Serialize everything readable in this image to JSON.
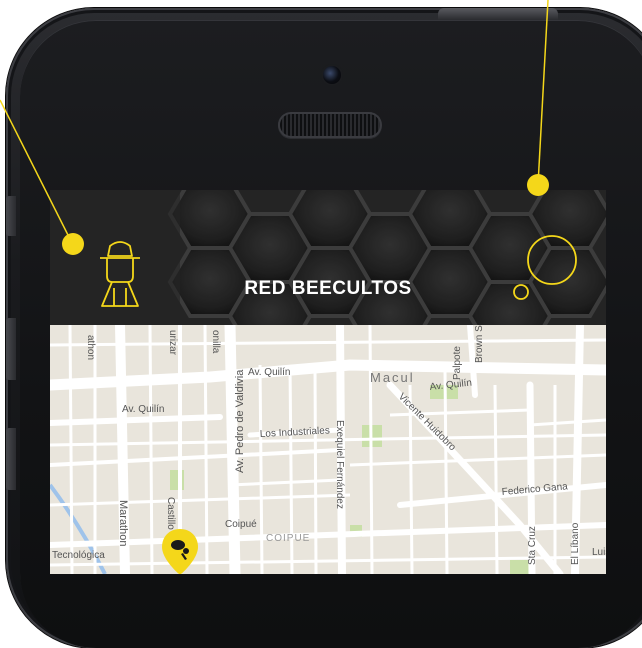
{
  "app": {
    "title": "RED BEECULTOS"
  },
  "colors": {
    "accent": "#f4d71a",
    "header_bg": "#2a2a2a",
    "map_bg": "#e8e4dc",
    "road": "#ffffff"
  },
  "icons": {
    "logo": "beekeeper-icon",
    "menu": "bubbles-icon",
    "pin": "bee-marker-icon"
  },
  "map": {
    "street_labels": [
      "Av. Quilín",
      "Av. Quilín",
      "Av. Quilín",
      "Macul",
      "Av. Pedro de Valdivia",
      "Los Industriales",
      "Exequiel Fernández",
      "Vicente Huidobro",
      "Palpote",
      "Brown S",
      "Marathon",
      "Castillo U",
      "Coipué",
      "COIPUE",
      "Federico Gana",
      "Sta Cruz",
      "El Líbano",
      "Luis",
      "Tecnológica",
      "athon",
      "urizar",
      "onilla"
    ]
  }
}
